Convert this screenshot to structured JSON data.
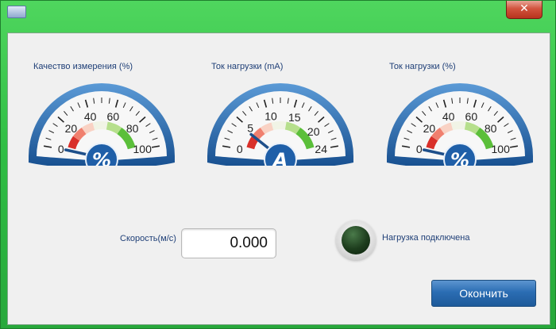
{
  "window": {
    "close_label": "✕"
  },
  "gauges": [
    {
      "label": "Качество измерения (%)",
      "ticks": [
        "0",
        "20",
        "40",
        "60",
        "80",
        "100"
      ],
      "min": 0,
      "max": 100,
      "value": 0,
      "unit_symbol": "%"
    },
    {
      "label": "Ток нагрузки (mA)",
      "ticks": [
        "0",
        "5",
        "10",
        "15",
        "20",
        "24"
      ],
      "min": 0,
      "max": 24,
      "value": 4,
      "unit_symbol": "A"
    },
    {
      "label": "Ток нагрузки (%)",
      "ticks": [
        "0",
        "20",
        "40",
        "60",
        "80",
        "100"
      ],
      "min": 0,
      "max": 100,
      "value": 0,
      "unit_symbol": "%"
    }
  ],
  "speed": {
    "label": "Скорость(м/с)",
    "value": "0.000"
  },
  "load_indicator": {
    "label": "Нагрузка подключена",
    "color_off": "#1d3d1d"
  },
  "finish_button": {
    "label": "Окончить"
  },
  "colors": {
    "title_green": "#2fbe44",
    "gauge_blue": "#1f5fa8",
    "button_blue": "#2b6db3"
  }
}
